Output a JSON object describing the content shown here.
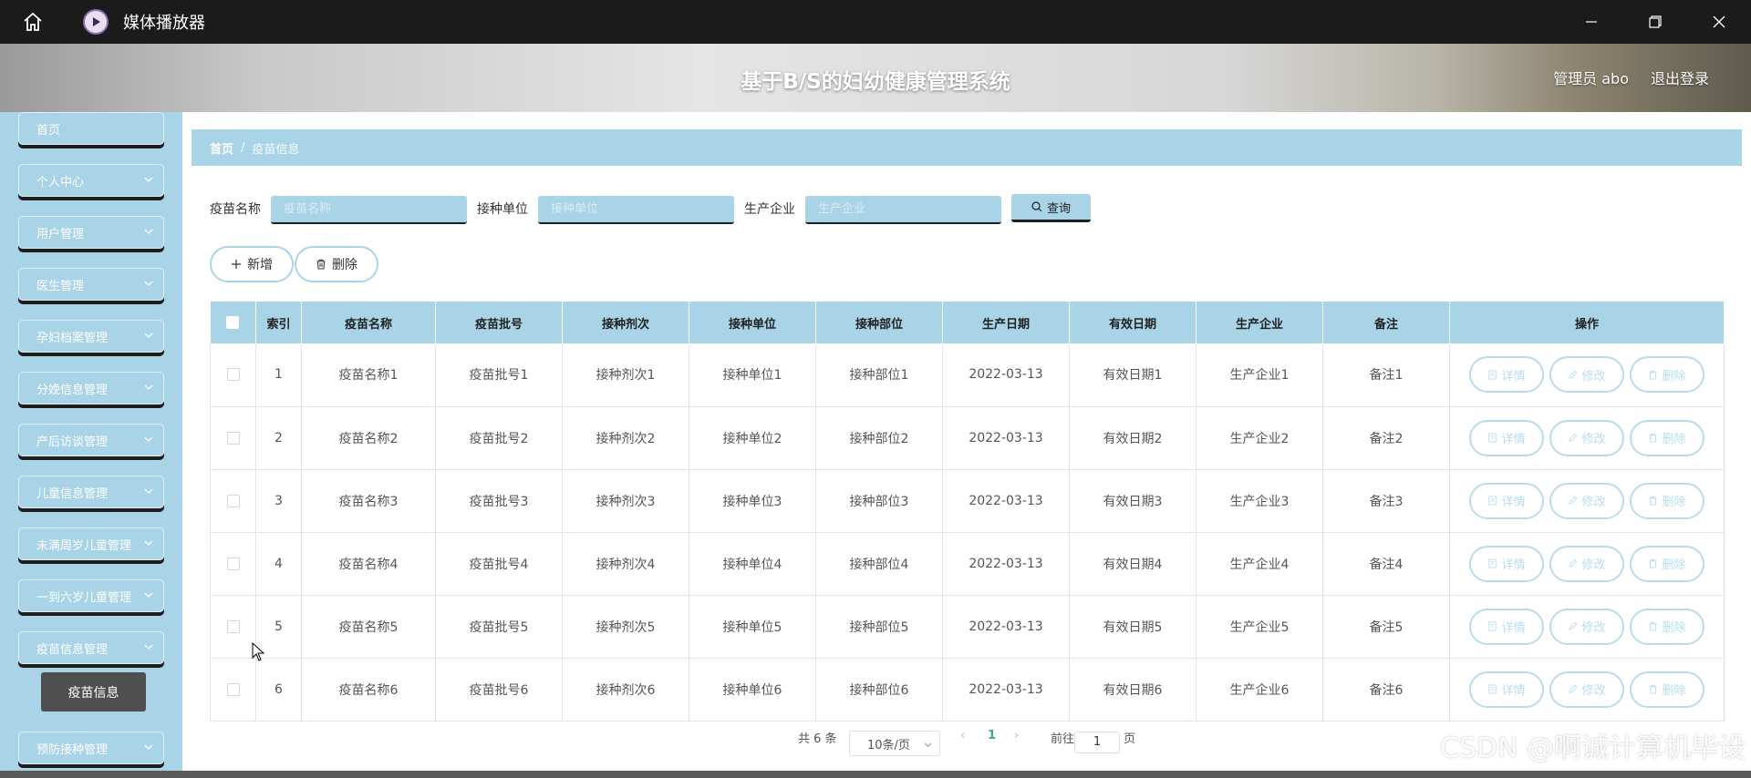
{
  "window": {
    "title": "媒体播放器"
  },
  "header": {
    "title": "基于B/S的妇幼健康管理系统",
    "user": "管理员 abo",
    "logout": "退出登录"
  },
  "sidebar": {
    "items": [
      {
        "label": "首页",
        "has_children": false
      },
      {
        "label": "个人中心",
        "has_children": true
      },
      {
        "label": "用户管理",
        "has_children": true
      },
      {
        "label": "医生管理",
        "has_children": true
      },
      {
        "label": "孕妇档案管理",
        "has_children": true
      },
      {
        "label": "分娩信息管理",
        "has_children": true
      },
      {
        "label": "产后访谈管理",
        "has_children": true
      },
      {
        "label": "儿童信息管理",
        "has_children": true
      },
      {
        "label": "未满周岁儿童管理",
        "has_children": true
      },
      {
        "label": "一到六岁儿童管理",
        "has_children": true
      },
      {
        "label": "疫苗信息管理",
        "has_children": true
      },
      {
        "label": "预防接种管理",
        "has_children": true
      }
    ],
    "active_sub": "疫苗信息"
  },
  "breadcrumb": {
    "home": "首页",
    "current": "疫苗信息"
  },
  "search": {
    "name_label": "疫苗名称",
    "name_placeholder": "疫苗名称",
    "unit_label": "接种单位",
    "unit_placeholder": "接种单位",
    "company_label": "生产企业",
    "company_placeholder": "生产企业",
    "button": "查询"
  },
  "actions": {
    "add": "新增",
    "delete": "删除"
  },
  "table": {
    "columns": [
      "索引",
      "疫苗名称",
      "疫苗批号",
      "接种剂次",
      "接种单位",
      "接种部位",
      "生产日期",
      "有效日期",
      "生产企业",
      "备注",
      "操作"
    ],
    "rows": [
      [
        "1",
        "疫苗名称1",
        "疫苗批号1",
        "接种剂次1",
        "接种单位1",
        "接种部位1",
        "2022-03-13",
        "有效日期1",
        "生产企业1",
        "备注1"
      ],
      [
        "2",
        "疫苗名称2",
        "疫苗批号2",
        "接种剂次2",
        "接种单位2",
        "接种部位2",
        "2022-03-13",
        "有效日期2",
        "生产企业2",
        "备注2"
      ],
      [
        "3",
        "疫苗名称3",
        "疫苗批号3",
        "接种剂次3",
        "接种单位3",
        "接种部位3",
        "2022-03-13",
        "有效日期3",
        "生产企业3",
        "备注3"
      ],
      [
        "4",
        "疫苗名称4",
        "疫苗批号4",
        "接种剂次4",
        "接种单位4",
        "接种部位4",
        "2022-03-13",
        "有效日期4",
        "生产企业4",
        "备注4"
      ],
      [
        "5",
        "疫苗名称5",
        "疫苗批号5",
        "接种剂次5",
        "接种单位5",
        "接种部位5",
        "2022-03-13",
        "有效日期5",
        "生产企业5",
        "备注5"
      ],
      [
        "6",
        "疫苗名称6",
        "疫苗批号6",
        "接种剂次6",
        "接种单位6",
        "接种部位6",
        "2022-03-13",
        "有效日期6",
        "生产企业6",
        "备注6"
      ]
    ],
    "row_actions": {
      "detail": "详情",
      "edit": "修改",
      "delete": "删除"
    }
  },
  "pagination": {
    "total": "共 6 条",
    "page_size": "10条/页",
    "current_page": "1",
    "goto_label": "前往",
    "goto_value": "1",
    "page_suffix": "页"
  },
  "watermark": "CSDN @啊诚计算机毕设",
  "colors": {
    "accent": "#a9d4e8",
    "active_page": "#3fa58a"
  }
}
